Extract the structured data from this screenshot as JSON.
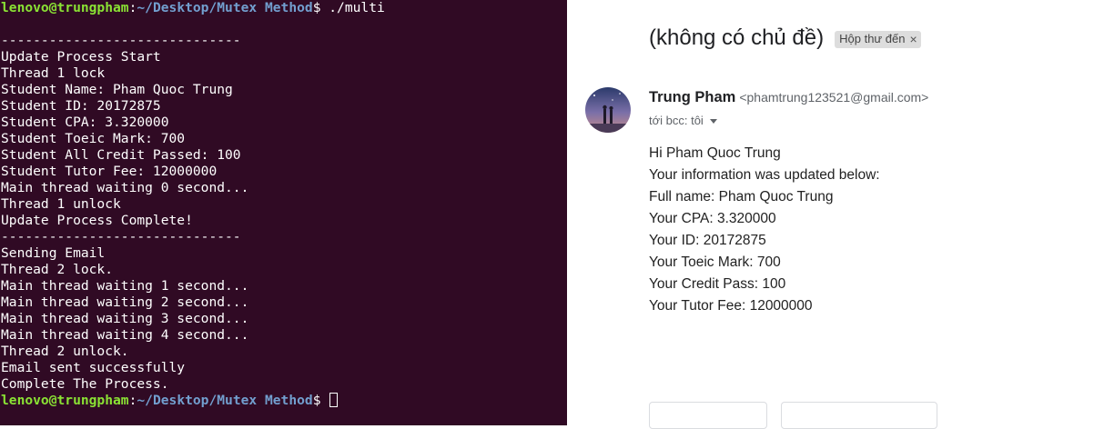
{
  "terminal": {
    "prompt_user": "lenovo@trungpham",
    "prompt_sep": ":",
    "prompt_path": "~/Desktop/Mutex Method",
    "prompt_symbol": "$",
    "command": " ./multi",
    "output": [
      "",
      "------------------------------",
      "Update Process Start",
      "Thread 1 lock",
      "Student Name: Pham Quoc Trung",
      "Student ID: 20172875",
      "Student CPA: 3.320000",
      "Student Toeic Mark: 700",
      "Student All Credit Passed: 100",
      "Student Tutor Fee: 12000000",
      "Main thread waiting 0 second...",
      "Thread 1 unlock",
      "Update Process Complete!",
      "------------------------------",
      "Sending Email",
      "Thread 2 lock.",
      "Main thread waiting 1 second...",
      "Main thread waiting 2 second...",
      "Main thread waiting 3 second...",
      "Main thread waiting 4 second...",
      "Thread 2 unlock.",
      "Email sent successfully",
      "Complete The Process."
    ]
  },
  "email": {
    "subject": "(không có chủ đề)",
    "label": "Hộp thư đến",
    "label_close": "×",
    "sender_name": "Trung Pham",
    "sender_email": "<phamtrung123521@gmail.com>",
    "recipient": "tới bcc: tôi",
    "body": [
      "Hi Pham Quoc Trung",
      "Your information was updated below:",
      "Full name: Pham Quoc Trung",
      "Your CPA: 3.320000",
      "Your ID: 20172875",
      "Your Toeic Mark: 700",
      "Your Credit Pass: 100",
      "Your Tutor Fee: 12000000"
    ]
  }
}
